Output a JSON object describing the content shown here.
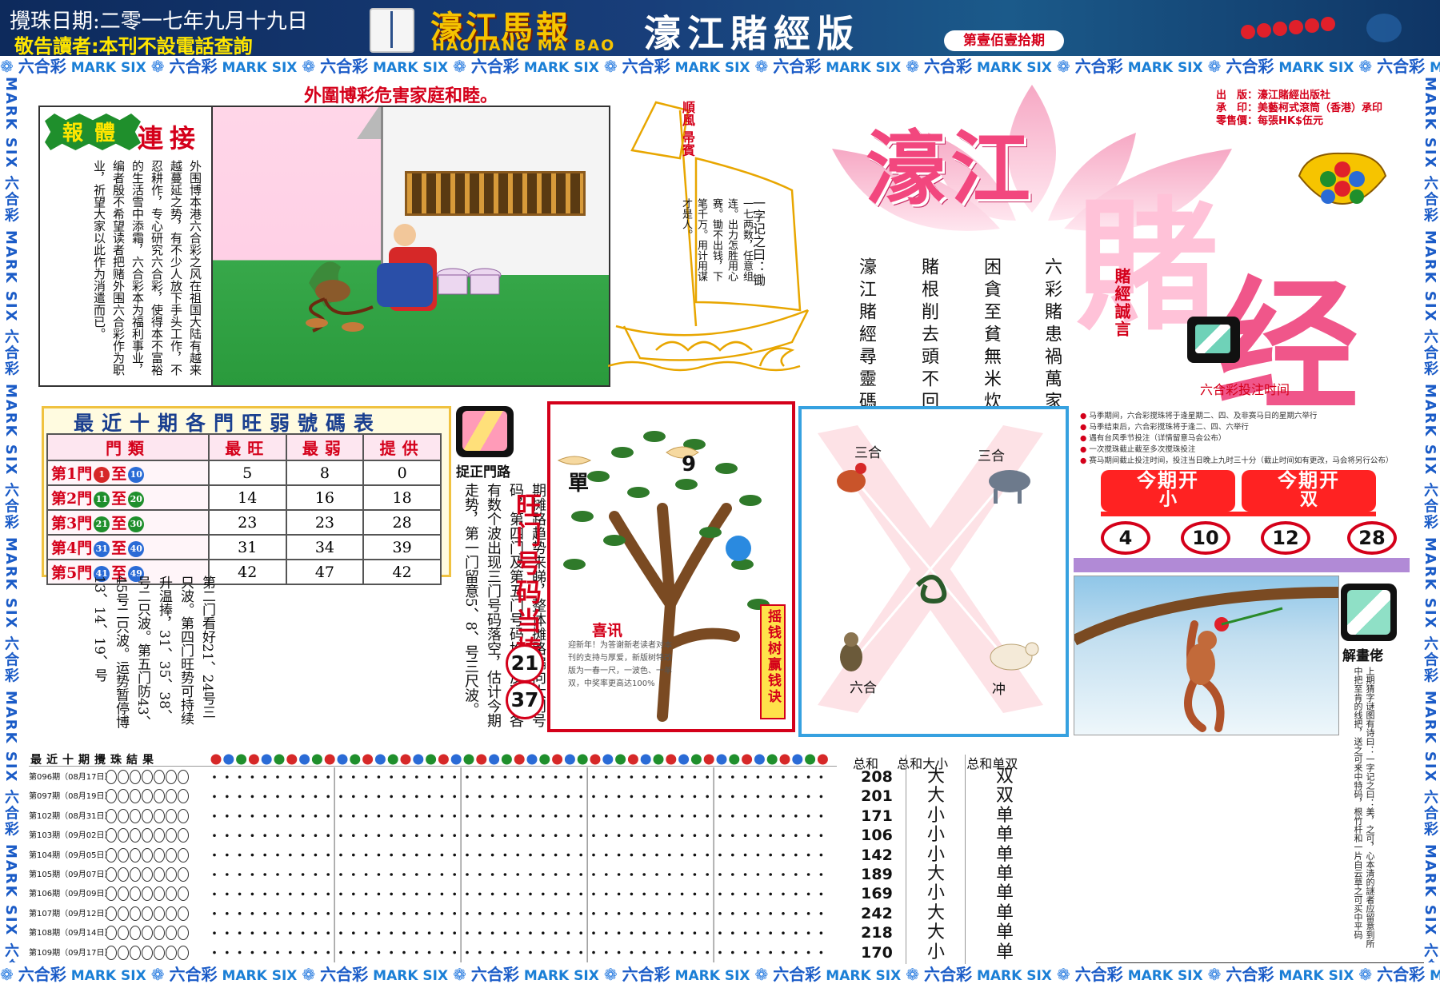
{
  "header": {
    "date": "攪珠日期:二零一七年九月十九日",
    "notice": "敬告讀者:本刊不設電話查詢",
    "logo_cn": "濠江馬報",
    "logo_en": "HAOJIANG MA BAO",
    "edition": "濠江賭經版",
    "issue": "第壹佰壹拾期"
  },
  "strip_items": [
    "六合彩",
    "MARK SIX"
  ],
  "side_text": "MARK SIX 六合彩 MARK SIX 六合彩 MARK SIX 六合彩 MARK SIX 六合彩 MARK SIX 六合彩 MARK SIX 六合彩",
  "article": {
    "headline": "外圍博彩危害家庭和睦。",
    "badge": "報體",
    "title": "連接",
    "body": "外围博本港六合彩之风在祖国大陆有越来越蔓延之势，有不少人放下手头工作，不忍耕作，专心研究六合彩，使得本不富裕的生活雪中添霜，六合彩本为福利事业，编者殷不希望读者把赌外围六合彩作为职业，祈望大家以此作为消遣而已。"
  },
  "sailboat": {
    "flag": "順風 帚賓",
    "poem": "一七两数，任意组连。出力怎胜用心赛。锄不出钱，下笔千万。用计用谋才是人。",
    "riddle": "一字记之曰：锄"
  },
  "masthead": {
    "title_1": "濠江",
    "title_2": "賭",
    "title_3": "经",
    "pub_info": [
      "出　版：濠江賭經出版社",
      "承　印：美藝柯式滾筒（香港）承印",
      "零售價：每張HK$伍元"
    ],
    "gamble_say": "賭經誠言",
    "poem_cols": [
      "六彩賭患禍萬家",
      "困貪至貧無米炊",
      "賭根削去頭不回",
      "濠江賭經尋靈碼"
    ],
    "time_label": "六合彩投注时间"
  },
  "rank_table": {
    "title": "最近十期各門旺弱號碼表",
    "headers": [
      "門類",
      "最旺",
      "最弱",
      "提供"
    ],
    "rows": [
      {
        "door": "第1門",
        "from": "1",
        "to": "10",
        "to_word": "至",
        "hot": "5",
        "cold": "8",
        "give": "0"
      },
      {
        "door": "第2門",
        "from": "11",
        "to": "20",
        "to_word": "至",
        "hot": "14",
        "cold": "16",
        "give": "18"
      },
      {
        "door": "第3門",
        "from": "21",
        "to": "30",
        "to_word": "至",
        "hot": "23",
        "cold": "23",
        "give": "28"
      },
      {
        "door": "第4門",
        "from": "31",
        "to": "40",
        "to_word": "至",
        "hot": "31",
        "cold": "34",
        "give": "39"
      },
      {
        "door": "第5門",
        "from": "41",
        "to": "49",
        "to_word": "至",
        "hot": "42",
        "cold": "47",
        "give": "42"
      }
    ]
  },
  "route": {
    "label": "捉正門路",
    "notice": "敬告读者：近期发现内地市场上有本刊的翻版，虽内容雷同，但字迹模糊，错误百出，鱼目混珠。有损读者利益，本刊敬请读者朋友购读本刊，须认明原版致误。上期开出码总分170为小，从上期摊路趋势来睇，整体摊路偏向大门号码，第四门及第五门号码均见反弹，各有数个波出现三门号码落空，估计今期走势，第一门留意5、8、号三尺波。",
    "analysis": "第二门看好21、24号三只波。第四门旺势可持续升温捧，31、35、38、号二只波。第五门防43、45号二只波。运势暂停博13、14、19、号",
    "wang_title": "旺门号码当捧",
    "picks": [
      "21",
      "37"
    ]
  },
  "tree": {
    "dan": "單",
    "nine": "9",
    "tag": "摇钱树赢钱诀",
    "xixun": "喜讯",
    "xixun_body": "迎新年！为答谢新老读者对本刊的支持与厚爱，新版树特改版为一春一尺，一波色、一单双，中奖率更高达100%"
  },
  "zodiac": {
    "tl": "三合",
    "tr": "三合",
    "bl": "六合",
    "br": "冲"
  },
  "rules": [
    "马季期间，六合彩搅珠将于逢星期二、四、及非赛马日的星期六举行",
    "马季结束后，六合彩搅珠将于逢二、四、六举行",
    "遇有台风季节投注（详情留意马会公布）",
    "一次搅珠截止截至多次搅珠投注",
    "赛马期间截止投注时间，投注当日晚上九时三十分（截止时间如有更改，马会将另行公布）"
  ],
  "current": {
    "tab1_top": "今期开",
    "tab1_bottom": "小",
    "tab2_top": "今期开",
    "tab2_bottom": "双",
    "numbers": [
      "4",
      "10",
      "12",
      "28"
    ]
  },
  "jiehua": {
    "label": "解畫佬",
    "text": "上期猜字谜图有诗曰：一字记之曰：美，之可，心本清的謎者应留意到所中把至肯的线把，送之可来中特码，根竹杆和一片白云草之可买中平码"
  },
  "results": {
    "title": "最近十期攪珠結果",
    "rows": [
      {
        "label": "第096期（08月17日）",
        "sum": "208",
        "size": "大",
        "parity": "双"
      },
      {
        "label": "第097期（08月19日）",
        "sum": "201",
        "size": "大",
        "parity": "双"
      },
      {
        "label": "第102期（08月31日）",
        "sum": "171",
        "size": "小",
        "parity": "单"
      },
      {
        "label": "第103期（09月02日）",
        "sum": "106",
        "size": "小",
        "parity": "单"
      },
      {
        "label": "第104期（09月05日）",
        "sum": "142",
        "size": "小",
        "parity": "单"
      },
      {
        "label": "第105期（09月07日）",
        "sum": "189",
        "size": "大",
        "parity": "单"
      },
      {
        "label": "第106期（09月09日）",
        "sum": "169",
        "size": "小",
        "parity": "单"
      },
      {
        "label": "第107期（09月12日）",
        "sum": "242",
        "size": "大",
        "parity": "单"
      },
      {
        "label": "第108期（09月14日）",
        "sum": "218",
        "size": "大",
        "parity": "单"
      },
      {
        "label": "第109期（09月17日）",
        "sum": "170",
        "size": "小",
        "parity": "单"
      }
    ],
    "head_sum": "总和",
    "head_size": "总和大小",
    "head_parity": "总和单双"
  },
  "colors": {
    "red": "#d4001a",
    "blue": "#1a5bc7",
    "green": "#1f8f2c",
    "pink": "#f2477e"
  }
}
